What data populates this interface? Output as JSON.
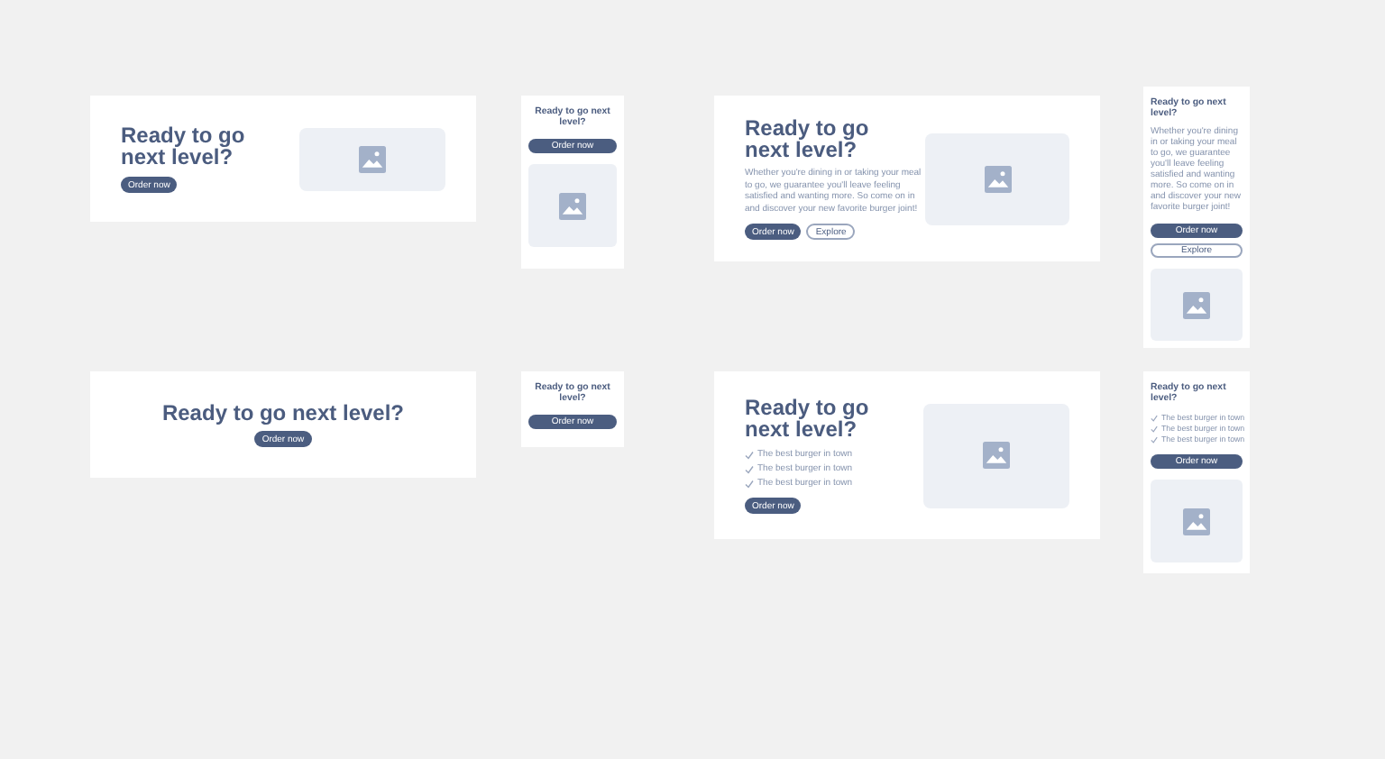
{
  "frames": [
    {
      "kind": "split",
      "centered_text": false,
      "title": "Ready to go next level?",
      "buttons": [
        {
          "label": "Order now",
          "kind": "primary"
        }
      ],
      "image": true
    },
    {
      "kind": "stacked",
      "centered_text": true,
      "title": "Ready to go next level?",
      "buttons": [
        {
          "label": "Order now",
          "kind": "primary"
        }
      ],
      "image": true
    },
    {
      "kind": "split",
      "centered_text": false,
      "title": "Ready to go next level?",
      "description": "Whether you're dining in or taking your meal to go, we guarantee you'll leave feeling satisfied and wanting more. So come on in and discover your new favorite burger joint!",
      "buttons": [
        {
          "label": "Order now",
          "kind": "primary"
        },
        {
          "label": "Explore",
          "kind": "secondary"
        }
      ],
      "image": true
    },
    {
      "kind": "stacked",
      "centered_text": false,
      "title": "Ready to go next level?",
      "description": "Whether you're dining in or taking your meal to go, we guarantee you'll leave feeling satisfied and wanting more. So come on in and discover your new favorite burger joint!",
      "buttons": [
        {
          "label": "Order now",
          "kind": "primary"
        },
        {
          "label": "Explore",
          "kind": "secondary"
        }
      ],
      "image": true
    },
    {
      "kind": "centered",
      "centered_text": true,
      "title": "Ready to go next level?",
      "buttons": [
        {
          "label": "Order now",
          "kind": "primary"
        }
      ],
      "image": false
    },
    {
      "kind": "stacked",
      "centered_text": true,
      "title": "Ready to go next level?",
      "buttons": [
        {
          "label": "Order now",
          "kind": "primary"
        }
      ],
      "image": false
    },
    {
      "kind": "split",
      "centered_text": false,
      "title": "Ready to go next level?",
      "features": [
        "The best burger in town",
        "The best burger in town",
        "The best burger in town"
      ],
      "buttons": [
        {
          "label": "Order now",
          "kind": "primary"
        }
      ],
      "image": true
    },
    {
      "kind": "stacked",
      "centered_text": false,
      "title": "Ready to go next level?",
      "features": [
        "The best burger in town",
        "The best burger in town",
        "The best burger in town"
      ],
      "buttons": [
        {
          "label": "Order now",
          "kind": "primary"
        }
      ],
      "image": true
    }
  ]
}
